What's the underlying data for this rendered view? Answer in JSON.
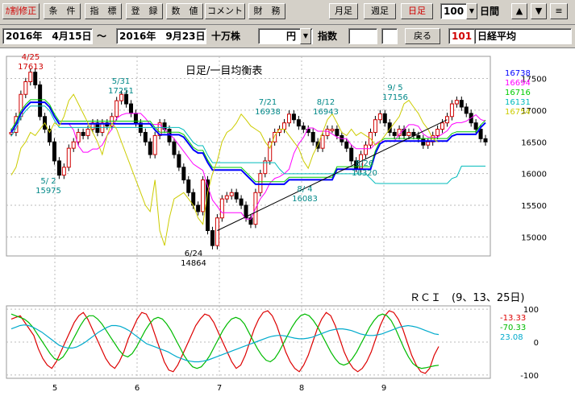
{
  "toolbar": {
    "buttons": [
      "ｶ割修正",
      "条　件",
      "指　標",
      "登　録",
      "数　値",
      "コメント",
      "財　務"
    ],
    "period_buttons": [
      "月足",
      "週足",
      "日足"
    ],
    "bar_count": "100",
    "unit": "日間",
    "arrow_up": "▲",
    "arrow_down": "▼",
    "menu": "≡"
  },
  "rangebar": {
    "start_date": "2016年　4月15日",
    "tilde": "～",
    "end_date": "2016年　9月23日",
    "volume_unit": "十万株",
    "currency": "円",
    "index_label": "指数",
    "back_button": "戻る",
    "code": "101",
    "name": "日経平均"
  },
  "chart_data": [
    {
      "type": "candlestick",
      "title": "日足/一目均衡表",
      "yticks": [
        15000,
        15500,
        16000,
        16500,
        17000,
        17500
      ],
      "ylim": [
        14700,
        17850
      ],
      "xticks": [
        "5",
        "6",
        "7",
        "8",
        "9"
      ],
      "grid": true,
      "legend_values": [
        {
          "value": "16738",
          "color": "#0000ff"
        },
        {
          "value": "16694",
          "color": "#ff00ff"
        },
        {
          "value": "16716",
          "color": "#00cc00"
        },
        {
          "value": "16131",
          "color": "#00bbbb"
        },
        {
          "value": "16754",
          "color": "#cccc00"
        }
      ],
      "annotations": [
        {
          "text": "4/25",
          "value": "17613",
          "color": "#d00000"
        },
        {
          "text": "5/31",
          "value": "17251",
          "color": "#008888"
        },
        {
          "text": "7/21",
          "value": "16938",
          "color": "#008888"
        },
        {
          "text": "8/12",
          "value": "16943",
          "color": "#008888"
        },
        {
          "text": "9/ 5",
          "value": "17156",
          "color": "#008888"
        },
        {
          "text": "5/ 2",
          "value": "15975",
          "color": "#008888"
        },
        {
          "text": "6/24",
          "value": "14864",
          "color": "#000000"
        },
        {
          "text": "8/ 4",
          "value": "16083",
          "color": "#008888"
        },
        {
          "text": "8/26",
          "value": "16320",
          "color": "#008888"
        }
      ],
      "series": [
        {
          "name": "close",
          "values": [
            16650,
            16900,
            17250,
            17450,
            17600,
            17400,
            16900,
            16700,
            16500,
            16200,
            15975,
            16100,
            16400,
            16500,
            16650,
            16600,
            16700,
            16800,
            16650,
            16800,
            16750,
            16900,
            17150,
            17250,
            17100,
            16950,
            16800,
            16650,
            16500,
            16300,
            16600,
            16800,
            16700,
            16500,
            16300,
            16100,
            15900,
            15700,
            15500,
            15400,
            15900,
            15100,
            14864,
            15300,
            15600,
            15650,
            15700,
            15600,
            15500,
            15300,
            15200,
            15700,
            16000,
            16200,
            16500,
            16650,
            16700,
            16800,
            16938,
            16850,
            16750,
            16700,
            16650,
            16500,
            16400,
            16600,
            16700,
            16700,
            16600,
            16500,
            16400,
            16200,
            16083,
            16300,
            16450,
            16650,
            16850,
            16943,
            16800,
            16650,
            16600,
            16700,
            16600,
            16650,
            16600,
            16550,
            16450,
            16500,
            16600,
            16700,
            16800,
            16900,
            17100,
            17156,
            17050,
            16950,
            16800,
            16700,
            16550,
            16500
          ]
        }
      ]
    },
    {
      "type": "line",
      "title": "ＲＣＩ　(9、13、25日)",
      "yticks": [
        100,
        0,
        -100
      ],
      "ylim": [
        -110,
        110
      ],
      "series": [
        {
          "value_label": "-13.33",
          "color": "#dd0000",
          "values": [
            70,
            75,
            80,
            60,
            40,
            20,
            -20,
            -50,
            -70,
            -80,
            -60,
            -30,
            0,
            30,
            60,
            80,
            90,
            70,
            40,
            10,
            -20,
            -50,
            -70,
            -80,
            -60,
            -30,
            10,
            40,
            70,
            90,
            85,
            60,
            20,
            -20,
            -60,
            -85,
            -90,
            -70,
            -40,
            -10,
            20,
            50,
            70,
            85,
            80,
            60,
            30,
            0,
            -30,
            -60,
            -80,
            -70,
            -40,
            0,
            40,
            70,
            90,
            95,
            80,
            50,
            10,
            -30,
            -60,
            -80,
            -90,
            -70,
            -40,
            0,
            40,
            70,
            90,
            80,
            50,
            10,
            -30,
            -60,
            -80,
            -90,
            -80,
            -60,
            -30,
            10,
            50,
            80,
            95,
            90,
            70,
            40,
            0,
            -40,
            -70,
            -90,
            -95,
            -80,
            -40,
            -13.33
          ]
        },
        {
          "value_label": "-70.33",
          "color": "#00bb00",
          "values": [
            85,
            80,
            75,
            70,
            60,
            45,
            25,
            5,
            -15,
            -35,
            -50,
            -55,
            -45,
            -25,
            0,
            25,
            50,
            70,
            80,
            80,
            70,
            55,
            35,
            15,
            -5,
            -25,
            -40,
            -45,
            -35,
            -15,
            10,
            35,
            55,
            70,
            75,
            70,
            55,
            35,
            10,
            -15,
            -40,
            -60,
            -75,
            -80,
            -75,
            -60,
            -40,
            -15,
            10,
            35,
            55,
            70,
            75,
            70,
            55,
            30,
            5,
            -20,
            -40,
            -55,
            -60,
            -50,
            -30,
            -5,
            20,
            45,
            65,
            80,
            85,
            80,
            65,
            45,
            20,
            -5,
            -30,
            -50,
            -65,
            -70,
            -65,
            -50,
            -30,
            -5,
            20,
            45,
            65,
            80,
            85,
            80,
            65,
            40,
            10,
            -20,
            -45,
            -65,
            -75,
            -80,
            -78,
            -75,
            -72,
            -70.33
          ]
        },
        {
          "value_label": "23.08",
          "color": "#00aacc",
          "values": [
            40,
            45,
            50,
            52,
            50,
            45,
            38,
            30,
            20,
            10,
            0,
            -10,
            -15,
            -18,
            -18,
            -15,
            -8,
            0,
            10,
            20,
            30,
            38,
            45,
            50,
            50,
            48,
            42,
            35,
            25,
            15,
            5,
            -5,
            -10,
            -15,
            -20,
            -25,
            -30,
            -38,
            -45,
            -50,
            -55,
            -58,
            -60,
            -60,
            -58,
            -55,
            -50,
            -45,
            -40,
            -35,
            -30,
            -25,
            -20,
            -15,
            -10,
            -5,
            0,
            5,
            10,
            15,
            18,
            20,
            20,
            18,
            15,
            12,
            10,
            10,
            12,
            15,
            20,
            25,
            30,
            35,
            38,
            40,
            40,
            38,
            35,
            30,
            25,
            22,
            20,
            20,
            22,
            25,
            30,
            35,
            40,
            45,
            48,
            50,
            48,
            45,
            40,
            35,
            30,
            25,
            23.08
          ]
        }
      ]
    }
  ]
}
